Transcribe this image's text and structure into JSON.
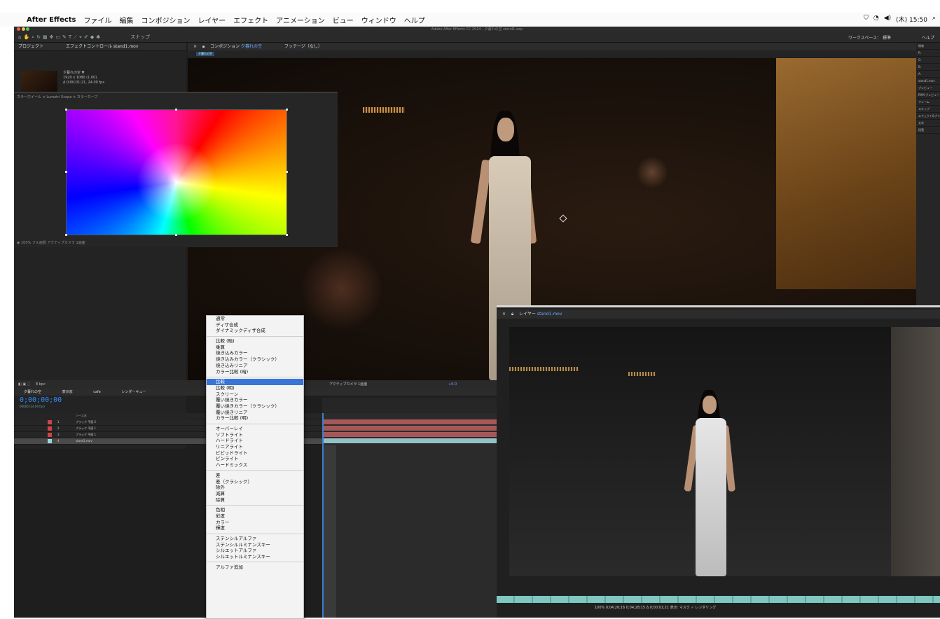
{
  "menubar": {
    "app": "After Effects",
    "items": [
      "ファイル",
      "編集",
      "コンポジション",
      "レイヤー",
      "エフェクト",
      "アニメーション",
      "ビュー",
      "ウィンドウ",
      "ヘルプ"
    ],
    "clock": "(木) 15:50"
  },
  "window": {
    "title": "Adobe After Effects CC 2014 - 夕暮れの空 stand1.aep"
  },
  "toolbar": {
    "snap_label": "スナップ",
    "workspace_label": "ワークスペース：",
    "workspace_value": "標準",
    "help_label": "ヘルプ"
  },
  "project": {
    "tab": "プロジェクト",
    "tab2": "エフェクトコントロール stand1.mov",
    "item_name": "夕暮れの空 ▼",
    "item_meta1": "1920 x 1080 (1.00)",
    "item_meta2": "Δ 0;00;01;21, 24.00 fps"
  },
  "wheel_window": {
    "tabs": "カラーホイール  ×   Lumetri Scope  ×   カラーカーブ",
    "footer": "◉ 100%   フル画質   アクティブカメラ   1画面"
  },
  "comp": {
    "tab_prefix": "コンポジション",
    "tab_name": "夕暮れの空",
    "tab2": "フッテージ（なし）",
    "chip": "夕暮れの空"
  },
  "right_panel": {
    "rows": [
      "情報",
      "R:",
      "G:",
      "B:",
      "A:",
      "stand1.mov",
      "プレビュー",
      "RAM プレビュー",
      "フレーム",
      "スキップ",
      "エフェクト&プリセット",
      "文字",
      "段落"
    ]
  },
  "layer_viewer": {
    "tab_prefix": "レイヤー",
    "tab_name": "stand1.mov",
    "footer": "100%   0;04;26;16   0;04;28;15   Δ 0;00;01;21   表示: マスク   ✓ レンダリング"
  },
  "timeline": {
    "bar_text": "8 bpc",
    "tabs": [
      "夕暮れの空",
      "表示窓",
      "cafe",
      "レンダーキュー"
    ],
    "timecode": "0;00;00;00",
    "fps": "00000 (24.00 fps)",
    "col_header": "ソース名",
    "layers": [
      {
        "num": "1",
        "name": "ブラック 平面 2",
        "color": "#d04545"
      },
      {
        "num": "2",
        "name": "ブラック 平面 1",
        "color": "#d04545"
      },
      {
        "num": "3",
        "name": "ブラック 平面 1",
        "color": "#d04545"
      },
      {
        "num": "4",
        "name": "stand1.mov",
        "color": "#9ad6e0"
      }
    ],
    "view_controls": "アクティブカメラ   1画面",
    "zoom": "+0.0"
  },
  "blend_menu": {
    "groups": [
      [
        "通常",
        "ディザ合成",
        "ダイナミックディザ合成"
      ],
      [
        "比較 (暗)",
        "乗算",
        "焼き込みカラー",
        "焼き込みカラー（クラシック）",
        "焼き込みリニア",
        "カラー比較 (暗)"
      ],
      [
        "比較",
        "比較 (明)",
        "スクリーン",
        "覆い焼きカラー",
        "覆い焼きカラー（クラシック）",
        "覆い焼きリニア",
        "カラー比較 (明)"
      ],
      [
        "オーバーレイ",
        "ソフトライト",
        "ハードライト",
        "リニアライト",
        "ビビッドライト",
        "ピンライト",
        "ハードミックス"
      ],
      [
        "差",
        "差（クラシック）",
        "除外",
        "減算",
        "除算"
      ],
      [
        "色相",
        "彩度",
        "カラー",
        "輝度"
      ],
      [
        "ステンシルアルファ",
        "ステンシルルミナンスキー",
        "シルエットアルファ",
        "シルエットルミナンスキー"
      ],
      [
        "アルファ追加"
      ]
    ],
    "highlighted": "比較"
  },
  "colors": {
    "accent_blue": "#3875d7",
    "timecode_blue": "#2f8fff",
    "layer_red": "#d04545",
    "layer_cyan": "#9ad6e0"
  }
}
